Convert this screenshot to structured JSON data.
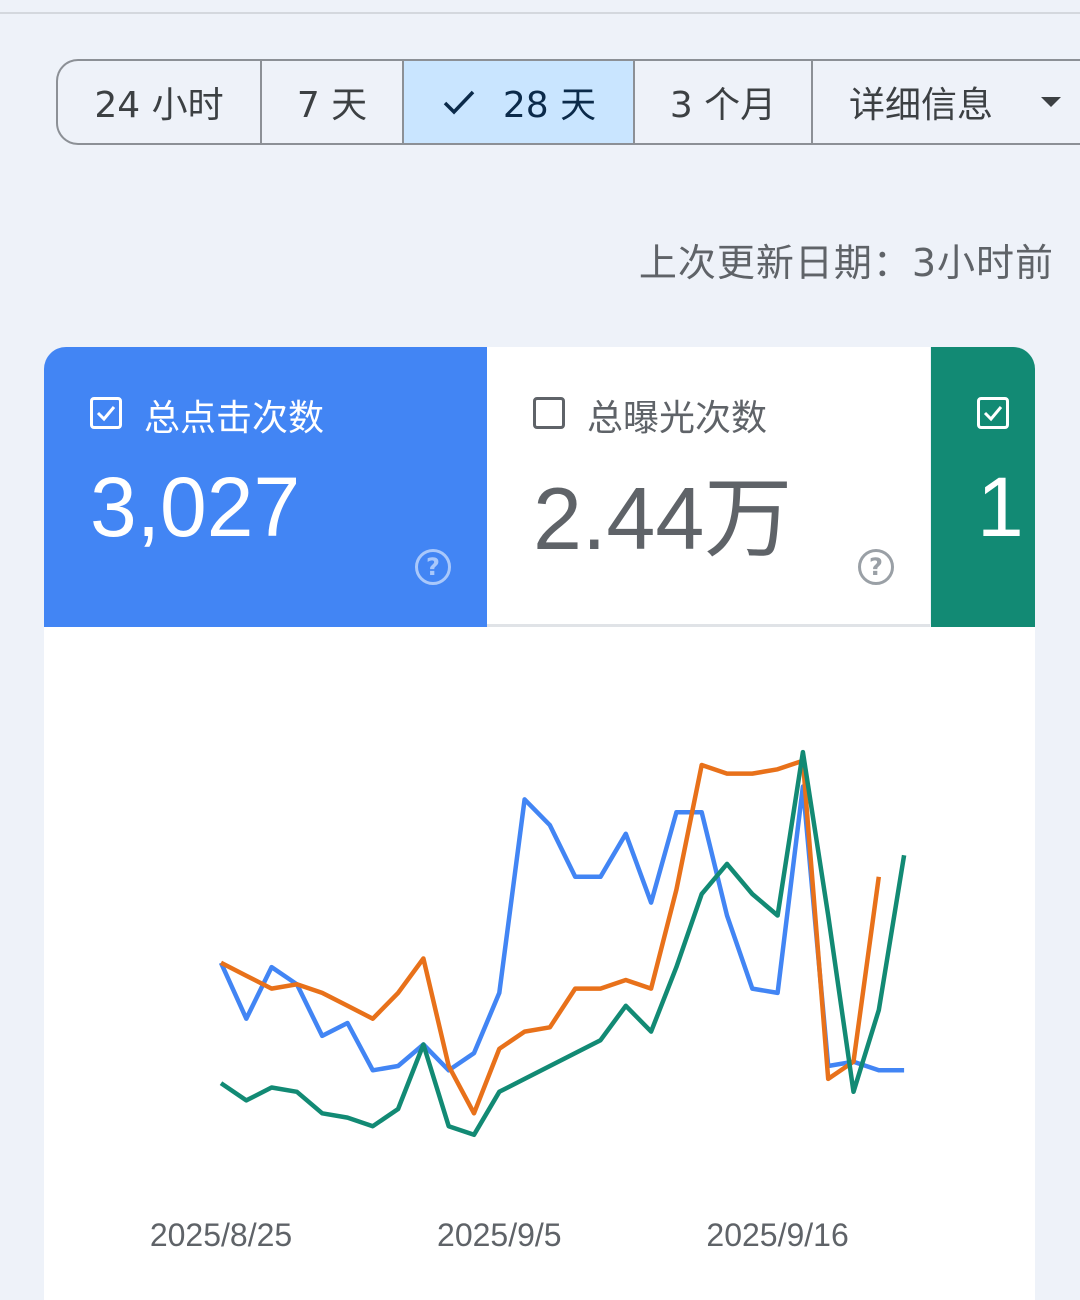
{
  "range_selector": {
    "options": [
      "24 小时",
      "7 天",
      "28 天",
      "3 个月"
    ],
    "selected": "28 天",
    "more_label": "详细信息"
  },
  "last_updated": "上次更新日期：3小时前",
  "metrics": [
    {
      "label": "总点击次数",
      "value": "3,027",
      "checked": true,
      "color": "#4285f4"
    },
    {
      "label": "总曝光次数",
      "value": "2.44万",
      "checked": false,
      "color": "#ffffff"
    },
    {
      "label": "",
      "value": "1",
      "checked": true,
      "color": "#128a74"
    }
  ],
  "chart_data": {
    "type": "line",
    "x_ticks": [
      "2025/8/25",
      "2025/9/5",
      "2025/9/16"
    ],
    "x": [
      "8/25",
      "8/26",
      "8/27",
      "8/28",
      "8/29",
      "8/30",
      "8/31",
      "9/1",
      "9/2",
      "9/3",
      "9/4",
      "9/5",
      "9/6",
      "9/7",
      "9/8",
      "9/9",
      "9/10",
      "9/11",
      "9/12",
      "9/13",
      "9/14",
      "9/15",
      "9/16",
      "9/17",
      "9/18",
      "9/19",
      "9/20",
      "9/21"
    ],
    "ylim": [
      0,
      100
    ],
    "series": [
      {
        "color": "#4285f4",
        "values": [
          44,
          31,
          43,
          39,
          27,
          30,
          19,
          20,
          25,
          19,
          23,
          37,
          82,
          76,
          64,
          64,
          74,
          58,
          79,
          79,
          55,
          38,
          37,
          85,
          20,
          21,
          19,
          19
        ]
      },
      {
        "color": "#e8711a",
        "values": [
          44,
          41,
          38,
          39,
          37,
          34,
          31,
          37,
          45,
          20,
          9,
          24,
          28,
          29,
          38,
          38,
          40,
          38,
          61,
          90,
          88,
          88,
          89,
          91,
          17,
          21,
          64
        ]
      },
      {
        "color": "#128a74",
        "values": [
          16,
          12,
          15,
          14,
          9,
          8,
          6,
          10,
          25,
          6,
          4,
          14,
          17,
          20,
          23,
          26,
          34,
          28,
          43,
          60,
          67,
          60,
          55,
          93,
          55,
          14,
          33,
          69
        ]
      }
    ]
  },
  "colors": {
    "blue": "#4285f4",
    "orange": "#e8711a",
    "teal": "#128a74",
    "selected_segment": "#c9e5ff"
  }
}
